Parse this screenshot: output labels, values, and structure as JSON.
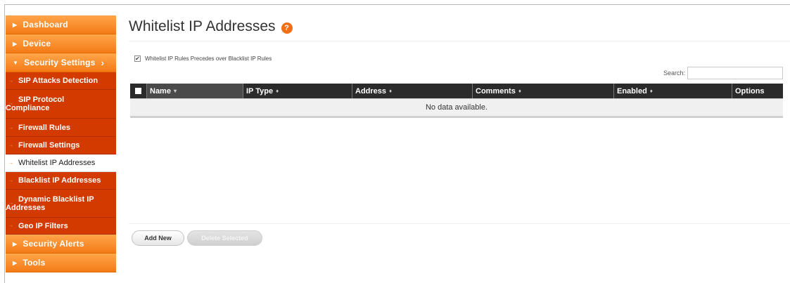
{
  "sidebar": {
    "top_items": [
      {
        "label": "Dashboard"
      },
      {
        "label": "Device"
      },
      {
        "label": "Security Settings"
      }
    ],
    "sub_items": [
      {
        "label": "SIP Attacks Detection"
      },
      {
        "label_line1": "SIP Protocol",
        "label_line2": "Compliance"
      },
      {
        "label": "Firewall Rules"
      },
      {
        "label": "Firewall Settings"
      },
      {
        "label": "Whitelist IP Addresses"
      },
      {
        "label": "Blacklist IP Addresses"
      },
      {
        "label_line1": "Dynamic Blacklist IP",
        "label_line2": "Addresses"
      },
      {
        "label": "Geo IP Filters"
      }
    ],
    "bottom_items": [
      {
        "label": "Security Alerts"
      },
      {
        "label": "Tools"
      }
    ]
  },
  "header": {
    "title": "Whitelist IP Addresses",
    "help_glyph": "?"
  },
  "options": {
    "whitelist_precedence_label": "Whitelist IP Rules Precedes over Blacklist IP Rules",
    "whitelist_precedence_checked": true
  },
  "search": {
    "label": "Search:",
    "value": ""
  },
  "table": {
    "columns": [
      "Name",
      "IP Type",
      "Address",
      "Comments",
      "Enabled",
      "Options"
    ],
    "sort_glyph_active": "▾",
    "sort_glyph": "♦",
    "empty_text": "No data available."
  },
  "buttons": {
    "add_new": "Add New",
    "delete_selected": "Delete Selected"
  },
  "colors": {
    "accent": "#f47a17",
    "nav_sub": "#d23a00",
    "header_bg": "#2b2b2b"
  }
}
